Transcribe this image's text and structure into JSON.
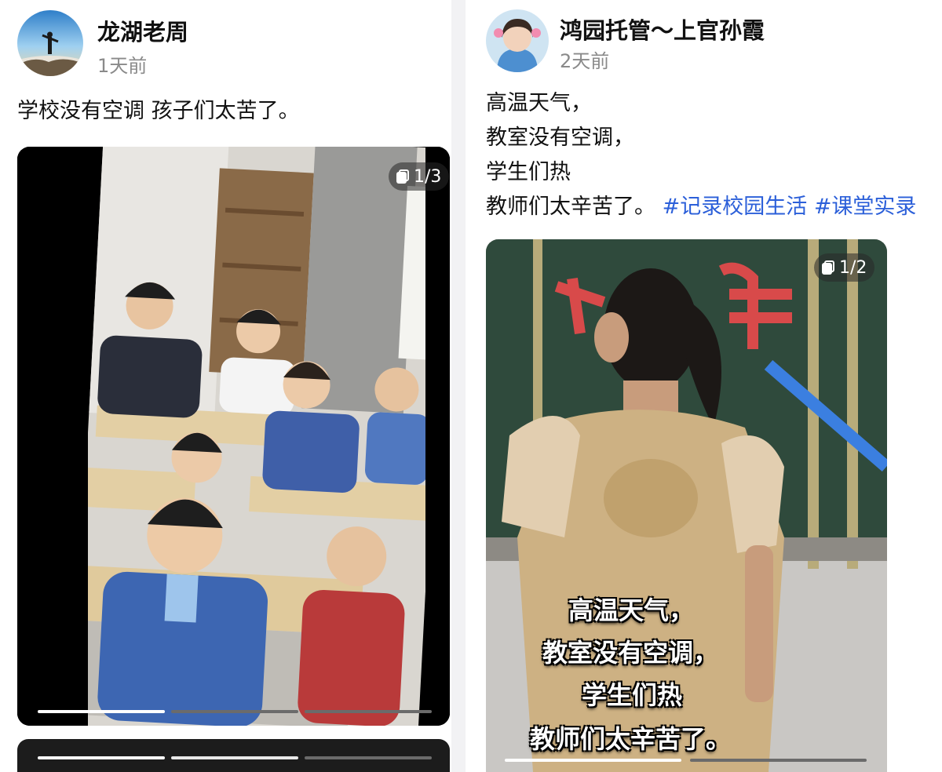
{
  "posts": [
    {
      "username": "龙湖老周",
      "time": "1天前",
      "caption": [
        "学校没有空调 孩子们太苦了。"
      ],
      "media": {
        "counter": "1/3",
        "description": "classroom of students sitting at desks"
      }
    },
    {
      "username": "鸿园托管～上官孙霞",
      "time": "2天前",
      "caption": [
        "高温天气，",
        "教室没有空调，",
        "学生们热"
      ],
      "caption_last": "教师们太辛苦了。",
      "hashtags": [
        "#记录校园生活",
        "#课堂实录"
      ],
      "media": {
        "counter": "1/2",
        "subtitles": [
          "高温天气，",
          "教室没有空调，",
          "学生们热",
          "教师们太辛苦了。"
        ],
        "description": "teacher facing blackboard with sweat-soaked shirt"
      }
    }
  ],
  "colors": {
    "hashtag": "#2b5fd9",
    "text": "#111111",
    "muted": "#8a8a8a"
  }
}
